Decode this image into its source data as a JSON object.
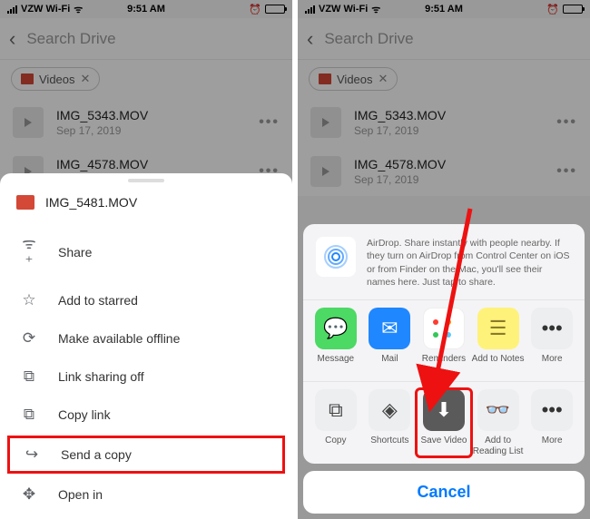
{
  "statusbar": {
    "carrier": "VZW Wi-Fi",
    "time": "9:51 AM"
  },
  "driveHeader": {
    "search": "Search Drive"
  },
  "chip": {
    "label": "Videos"
  },
  "files": [
    {
      "name": "IMG_5343.MOV",
      "date": "Sep 17, 2019"
    },
    {
      "name": "IMG_4578.MOV",
      "date": "Sep 17, 2019"
    }
  ],
  "leftSheet": {
    "title": "IMG_5481.MOV",
    "items": {
      "share": "Share",
      "starred": "Add to starred",
      "offline": "Make available offline",
      "linkoff": "Link sharing off",
      "copylink": "Copy link",
      "sendcopy": "Send a copy",
      "openin": "Open in"
    }
  },
  "rightSheet": {
    "airdrop": "AirDrop. Share instantly with people nearby. If they turn on AirDrop from Control Center on iOS or from Finder on the Mac, you'll see their names here. Just tap to share.",
    "row1": {
      "message": "Message",
      "mail": "Mail",
      "reminders": "Reminders",
      "notes": "Add to Notes",
      "more": "More"
    },
    "row2": {
      "copy": "Copy",
      "shortcuts": "Shortcuts",
      "savevideo": "Save Video",
      "readlist": "Add to\nReading List",
      "more": "More"
    },
    "cancel": "Cancel"
  }
}
